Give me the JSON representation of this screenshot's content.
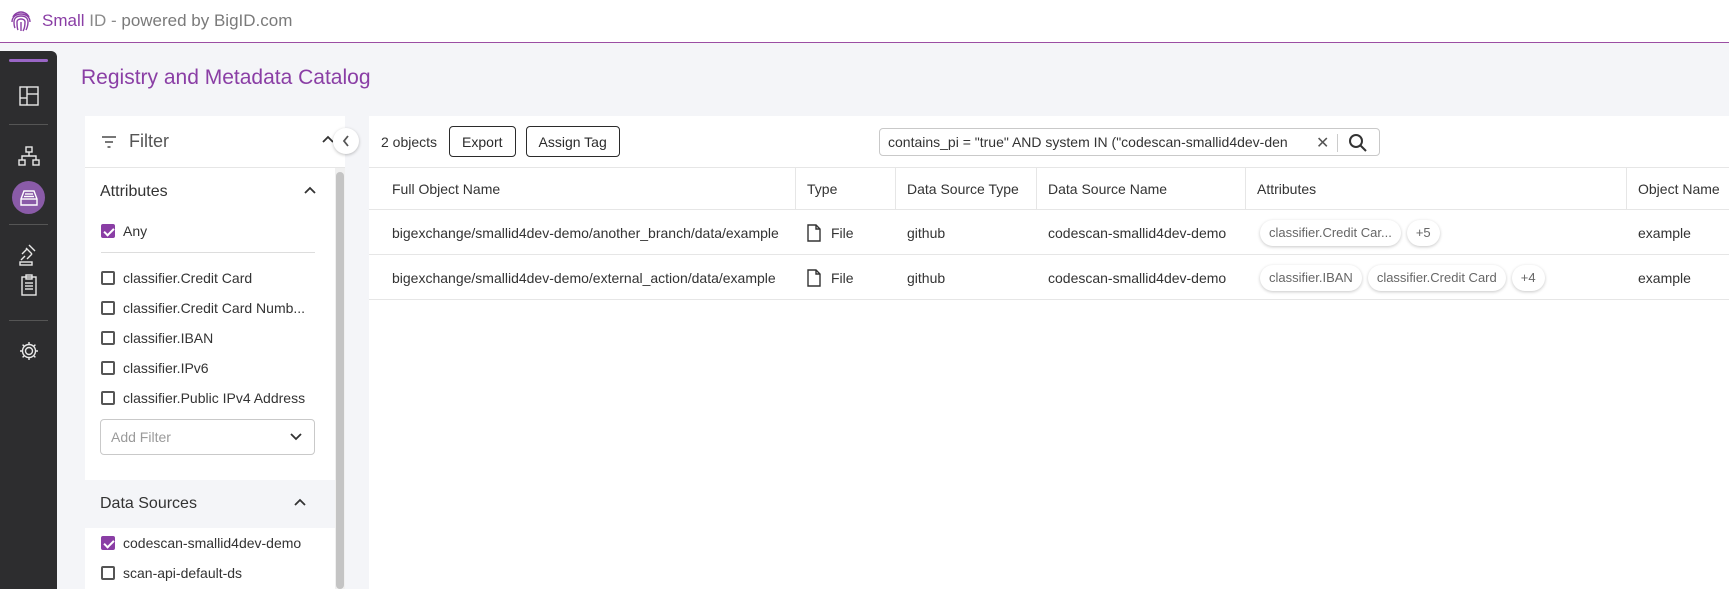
{
  "brand": {
    "app_name": "Small",
    "app_suffix": " ID - ",
    "tagline": "powered by BigID.com"
  },
  "page_title": "Registry and Metadata Catalog",
  "filter": {
    "title": "Filter",
    "attributes": {
      "heading": "Attributes",
      "any_label": "Any",
      "items": [
        "classifier.Credit Card",
        "classifier.Credit Card Numb...",
        "classifier.IBAN",
        "classifier.IPv6",
        "classifier.Public IPv4 Address"
      ],
      "add_filter_placeholder": "Add Filter"
    },
    "data_sources": {
      "heading": "Data Sources",
      "items": [
        {
          "label": "codescan-smallid4dev-demo",
          "checked": true
        },
        {
          "label": "scan-api-default-ds",
          "checked": false
        }
      ]
    }
  },
  "grid": {
    "count_label": "2 objects",
    "export_label": "Export",
    "assign_tag_label": "Assign Tag",
    "search_value": "contains_pi = \"true\" AND system IN (\"codescan-smallid4dev-den",
    "columns": [
      "Full Object Name",
      "Type",
      "Data Source Type",
      "Data Source Name",
      "Attributes",
      "Object Name"
    ],
    "rows": [
      {
        "full_name": "bigexchange/smallid4dev-demo/another_branch/data/example",
        "type": "File",
        "source_type": "github",
        "source_name": "codescan-smallid4dev-demo",
        "chips": [
          "classifier.Credit Car...",
          "+5"
        ],
        "object_name": "example"
      },
      {
        "full_name": "bigexchange/smallid4dev-demo/external_action/data/example",
        "type": "File",
        "source_type": "github",
        "source_name": "codescan-smallid4dev-demo",
        "chips": [
          "classifier.IBAN",
          "classifier.Credit Card",
          "+4"
        ],
        "object_name": "example"
      }
    ]
  },
  "colors": {
    "accent": "#8a3ea5",
    "nav_bg": "#2d2d2f",
    "nav_active": "#8a5ba8"
  },
  "icons": [
    "fingerprint-logo-icon",
    "dashboard-icon",
    "sitemap-icon",
    "catalog-icon",
    "gavel-icon",
    "clipboard-icon",
    "gear-icon",
    "filter-icon",
    "chevron-up-icon",
    "chevron-left-icon",
    "chevron-down-icon",
    "search-icon",
    "close-icon",
    "file-icon"
  ]
}
